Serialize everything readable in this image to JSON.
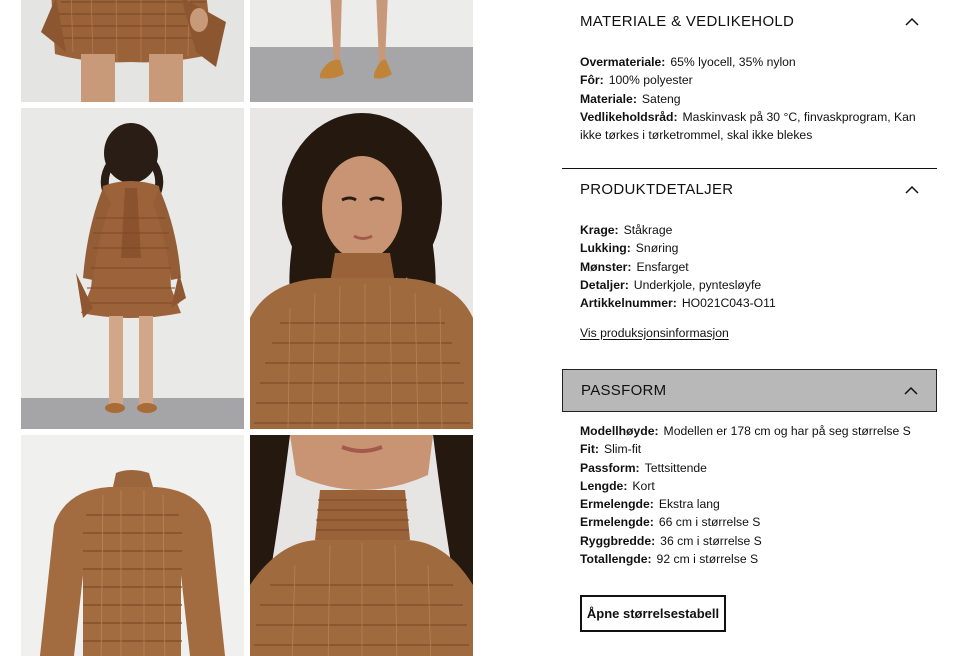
{
  "gallery": {
    "images": [
      {
        "alt": "",
        "label": ""
      },
      {
        "alt": "",
        "label": ""
      },
      {
        "alt": "",
        "label": ""
      },
      {
        "alt": "",
        "label": ""
      },
      {
        "alt": "",
        "label": ""
      },
      {
        "alt": "",
        "label": ""
      }
    ]
  },
  "colors": {
    "fabric": "#a0693f",
    "accent_selected": "#b8b8b8",
    "text": "#111111"
  },
  "accordion": {
    "materiale": {
      "title": "MATERIALE & VEDLIKEHOLD",
      "icon": "chevron-up-icon",
      "rows": [
        {
          "label": "Overmateriale:",
          "value": "65% lyocell, 35% nylon"
        },
        {
          "label": "Fôr:",
          "value": "100% polyester"
        },
        {
          "label": "Materiale:",
          "value": "Sateng"
        },
        {
          "label": "Vedlikeholdsråd:",
          "value": "Maskinvask på 30 °C, finvaskprogram, Kan ikke tørkes i tørketrommel, skal ikke blekes"
        }
      ]
    },
    "produktdetaljer": {
      "title": "PRODUKTDETALJER",
      "icon": "chevron-up-icon",
      "rows": [
        {
          "label": "Krage:",
          "value": "Ståkrage"
        },
        {
          "label": "Lukking:",
          "value": "Snøring"
        },
        {
          "label": "Mønster:",
          "value": "Ensfarget"
        },
        {
          "label": "Detaljer:",
          "value": "Underkjole, pyntesløyfe"
        },
        {
          "label": "Artikkelnummer:",
          "value": "HO021C043-O11"
        }
      ],
      "link": "Vis produksjonsinformasjon"
    },
    "passform": {
      "title": "PASSFORM",
      "icon": "chevron-up-icon",
      "rows": [
        {
          "label": "Modellhøyde:",
          "value": "Modellen er 178 cm og har på seg størrelse S"
        },
        {
          "label": "Fit:",
          "value": "Slim-fit"
        },
        {
          "label": "Passform:",
          "value": "Tettsittende"
        },
        {
          "label": "Lengde:",
          "value": "Kort"
        },
        {
          "label": "Ermelengde:",
          "value": "Ekstra lang"
        },
        {
          "label": "Ermelengde:",
          "value": "66 cm i størrelse S"
        },
        {
          "label": "Ryggbredde:",
          "value": "36 cm i størrelse S"
        },
        {
          "label": "Totallengde:",
          "value": "92 cm i størrelse S"
        }
      ],
      "button": "Åpne størrelsestabell"
    }
  }
}
